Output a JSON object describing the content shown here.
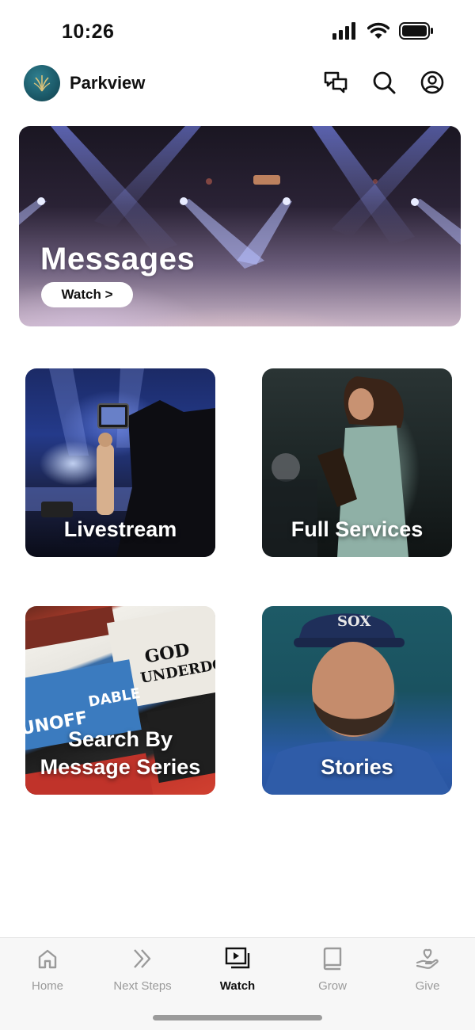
{
  "status_bar": {
    "time": "10:26",
    "icons": [
      "signal-icon",
      "wifi-icon",
      "battery-icon"
    ]
  },
  "header": {
    "app_name": "Parkview",
    "logo_icon": "parkview-logo-icon",
    "actions": [
      "chat-icon",
      "search-icon",
      "profile-icon"
    ]
  },
  "hero": {
    "title": "Messages",
    "button_label": "Watch >"
  },
  "tiles": [
    {
      "label": "Livestream"
    },
    {
      "label": "Full Services"
    },
    {
      "label_line1": "Search By",
      "label_line2": "Message Series"
    },
    {
      "label": "Stories"
    }
  ],
  "bottom_nav": {
    "active": "Watch",
    "items": [
      {
        "label": "Home",
        "icon": "home-icon"
      },
      {
        "label": "Next Steps",
        "icon": "double-chevron-icon"
      },
      {
        "label": "Watch",
        "icon": "video-library-icon"
      },
      {
        "label": "Grow",
        "icon": "book-icon"
      },
      {
        "label": "Give",
        "icon": "heart-hand-icon"
      }
    ]
  },
  "colors": {
    "active_nav": "#111111",
    "inactive_nav": "#9a9a9a",
    "logo_bg": "#1b5968"
  }
}
